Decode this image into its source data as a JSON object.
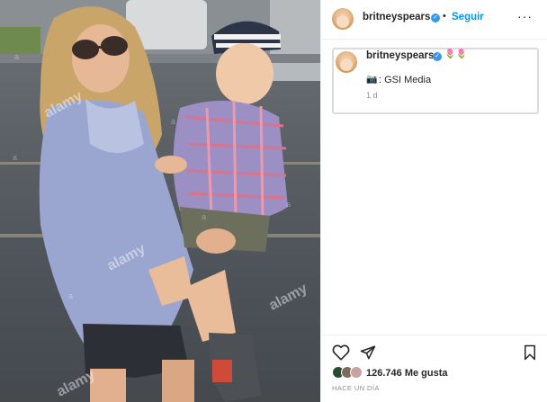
{
  "header": {
    "username": "britneyspears",
    "separator": "•",
    "follow_label": "Seguir",
    "more_label": "···"
  },
  "caption": {
    "username": "britneyspears",
    "emojis": "🌷🌷",
    "camera_emoji": "📷",
    "text": ": GSI Media",
    "time": "1 d"
  },
  "actions": {
    "likes_count": "126.746",
    "likes_label": "Me gusta",
    "date_label": "HACE UN DÍA"
  },
  "photo": {
    "watermark": "alamy",
    "watermark_letter": "a"
  },
  "icons": {
    "verified": "verified-badge-icon",
    "like": "heart-icon",
    "share": "paper-plane-icon",
    "save": "bookmark-icon",
    "camera": "camera-icon"
  },
  "colors": {
    "accent": "#0095f6",
    "verified": "#3797f0",
    "border": "#dbdbdb"
  }
}
